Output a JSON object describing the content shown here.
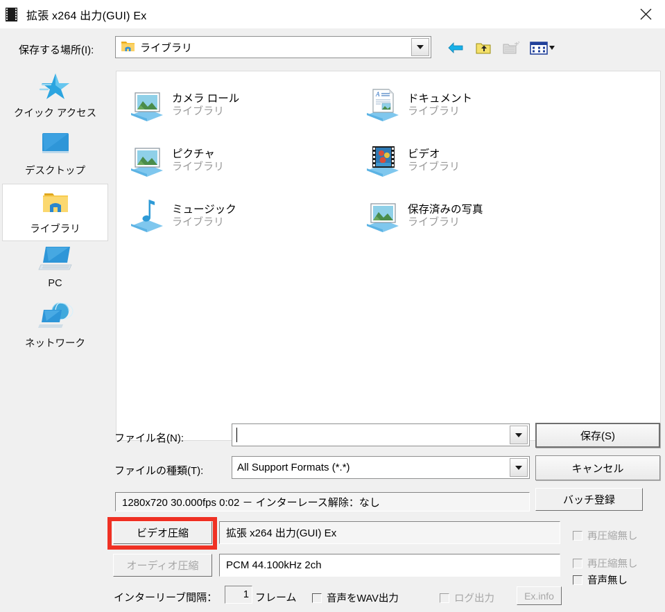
{
  "window": {
    "title": "拡張 x264 出力(GUI) Ex",
    "icon": "film-strip-icon",
    "close_label": "✕"
  },
  "lookin": {
    "label": "保存する場所(I):",
    "value": "ライブラリ",
    "icon": "library-folder-icon"
  },
  "toolbar": {
    "back": "back-arrow-icon",
    "up": "up-folder-icon",
    "new_folder": "new-folder-icon",
    "views": "views-icon"
  },
  "sidebar": {
    "items": [
      {
        "label": "クイック アクセス",
        "icon": "star-icon",
        "selected": false
      },
      {
        "label": "デスクトップ",
        "icon": "desktop-icon",
        "selected": false
      },
      {
        "label": "ライブラリ",
        "icon": "library-folder-icon",
        "selected": true
      },
      {
        "label": "PC",
        "icon": "pc-icon",
        "selected": false
      },
      {
        "label": "ネットワーク",
        "icon": "network-icon",
        "selected": false
      }
    ]
  },
  "filelist": {
    "items": [
      {
        "name": "カメラ ロール",
        "sub": "ライブラリ",
        "icon": "picture-library-icon"
      },
      {
        "name": "ドキュメント",
        "sub": "ライブラリ",
        "icon": "document-library-icon"
      },
      {
        "name": "ピクチャ",
        "sub": "ライブラリ",
        "icon": "picture-library-icon"
      },
      {
        "name": "ビデオ",
        "sub": "ライブラリ",
        "icon": "video-library-icon"
      },
      {
        "name": "ミュージック",
        "sub": "ライブラリ",
        "icon": "music-library-icon"
      },
      {
        "name": "保存済みの写真",
        "sub": "ライブラリ",
        "icon": "picture-library-icon"
      }
    ]
  },
  "form": {
    "filename_label": "ファイル名(N):",
    "filename_value": "",
    "filetype_label": "ファイルの種類(T):",
    "filetype_value": "All Support Formats (*.*)",
    "info_text": "1280x720  30.000fps  0:02  －  インターレース解除：なし"
  },
  "buttons": {
    "save": "保存(S)",
    "cancel": "キャンセル",
    "batch": "バッチ登録",
    "video_compress": "ビデオ圧縮",
    "audio_compress": "オーディオ圧縮",
    "ex_info": "Ex.info"
  },
  "codecs": {
    "video": "拡張 x264 出力(GUI) Ex",
    "audio": "PCM 44.100kHz 2ch"
  },
  "checkboxes": {
    "no_recompress_video": "再圧縮無し",
    "no_recompress_audio": "再圧縮無し",
    "no_audio": "音声無し",
    "wav_output": "音声をWAV出力",
    "log_output": "ログ出力"
  },
  "interleave": {
    "label": "インターリーブ間隔：",
    "value": "1",
    "unit": "フレーム"
  },
  "colors": {
    "highlight": "#ef3124",
    "dialog_bg": "#f0f0f0",
    "panel_bg": "#ffffff",
    "sub_text": "#999999"
  }
}
